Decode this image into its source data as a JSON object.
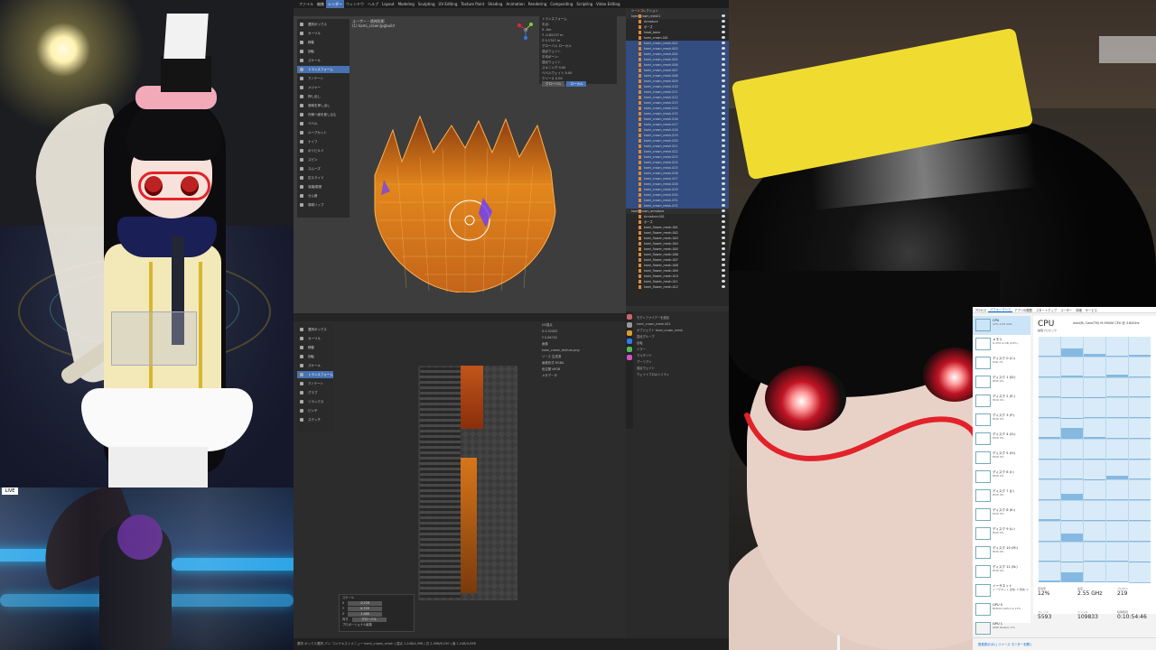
{
  "blender": {
    "menus": [
      "ファイル",
      "編集",
      "レンダー",
      "ウィンドウ",
      "ヘルプ",
      "Layout",
      "Modeling",
      "Sculpting",
      "UV Editing",
      "Texture Paint",
      "Shading",
      "Animation",
      "Rendering",
      "Compositing",
      "Scripting",
      "Video Editing"
    ],
    "active_menu_index": 2,
    "viewport": {
      "title": "ユーザー・透視投影",
      "subtitle": "(1) kami_crown|pgbuild",
      "tools": [
        "選択ボックス",
        "カーソル",
        "移動",
        "回転",
        "スケール",
        "トランスフォーム",
        "アノテート",
        "メジャー",
        "押し出し",
        "領域を押し出し",
        "内側へ面を差し込む",
        "ベベル",
        "ループカット",
        "ナイフ",
        "ポリビルド",
        "スピン",
        "スムーズ",
        "辺スライド",
        "収縮/膨張",
        "せん断",
        "領域リップ"
      ],
      "selected_tool_index": 5,
      "npanel": {
        "header": "トランスフォーム",
        "rows": [
          "中点:",
          "X  -0m",
          "Y  -0.62137 m",
          "Z  0.1747 m",
          "グローバル  ローカル",
          "頂点ウェイト",
          "平均ボーン:",
          "頂点ウェイト",
          "スキニング  0.00",
          "ベベルウェイト  0.00",
          "クリース  0.00"
        ],
        "tabs": [
          "グローバル",
          "ローカル"
        ]
      }
    },
    "outliner": {
      "title": "シーンコレクション",
      "rows": [
        {
          "label": "kami_crown_mesh1",
          "sel": false,
          "hdr": true
        },
        {
          "label": "Armature",
          "sel": false,
          "hdr": false
        },
        {
          "label": "ポーズ",
          "sel": false,
          "hdr": false
        },
        {
          "label": "head_bone",
          "sel": false,
          "hdr": false
        },
        {
          "label": "kami_crown.001",
          "sel": false,
          "hdr": false
        },
        {
          "label": "kami_crown_mesh.002",
          "sel": true,
          "hdr": false
        },
        {
          "label": "kami_crown_mesh.003",
          "sel": true,
          "hdr": false
        },
        {
          "label": "kami_crown_mesh.004",
          "sel": true,
          "hdr": false
        },
        {
          "label": "kami_crown_mesh.005",
          "sel": true,
          "hdr": false
        },
        {
          "label": "kami_crown_mesh.006",
          "sel": true,
          "hdr": false
        },
        {
          "label": "kami_crown_mesh.007",
          "sel": true,
          "hdr": false
        },
        {
          "label": "kami_crown_mesh.008",
          "sel": true,
          "hdr": false
        },
        {
          "label": "kami_crown_mesh.009",
          "sel": true,
          "hdr": false
        },
        {
          "label": "kami_crown_mesh.010",
          "sel": true,
          "hdr": false
        },
        {
          "label": "kami_crown_mesh.011",
          "sel": true,
          "hdr": false
        },
        {
          "label": "kami_crown_mesh.012",
          "sel": true,
          "hdr": false
        },
        {
          "label": "kami_crown_mesh.013",
          "sel": true,
          "hdr": false
        },
        {
          "label": "kami_crown_mesh.014",
          "sel": true,
          "hdr": false
        },
        {
          "label": "kami_crown_mesh.015",
          "sel": true,
          "hdr": false
        },
        {
          "label": "kami_crown_mesh.016",
          "sel": true,
          "hdr": false
        },
        {
          "label": "kami_crown_mesh.017",
          "sel": true,
          "hdr": false
        },
        {
          "label": "kami_crown_mesh.018",
          "sel": true,
          "hdr": false
        },
        {
          "label": "kami_crown_mesh.019",
          "sel": true,
          "hdr": false
        },
        {
          "label": "kami_crown_mesh.020",
          "sel": true,
          "hdr": false
        },
        {
          "label": "kami_crown_mesh.021",
          "sel": true,
          "hdr": false
        },
        {
          "label": "kami_crown_mesh.022",
          "sel": true,
          "hdr": false
        },
        {
          "label": "kami_crown_mesh.023",
          "sel": true,
          "hdr": false
        },
        {
          "label": "kami_crown_mesh.024",
          "sel": true,
          "hdr": false
        },
        {
          "label": "kami_crown_mesh.025",
          "sel": true,
          "hdr": false
        },
        {
          "label": "kami_crown_mesh.026",
          "sel": true,
          "hdr": false
        },
        {
          "label": "kami_crown_mesh.027",
          "sel": true,
          "hdr": false
        },
        {
          "label": "kami_crown_mesh.028",
          "sel": true,
          "hdr": false
        },
        {
          "label": "kami_crown_mesh.029",
          "sel": true,
          "hdr": false
        },
        {
          "label": "kami_crown_mesh.030",
          "sel": true,
          "hdr": false
        },
        {
          "label": "kami_crown_mesh.031",
          "sel": true,
          "hdr": false
        },
        {
          "label": "kami_crown_mesh.032",
          "sel": true,
          "hdr": false
        },
        {
          "label": "kami_crown_armature",
          "sel": false,
          "hdr": true
        },
        {
          "label": "Armature.001",
          "sel": false,
          "hdr": false
        },
        {
          "label": "ポーズ",
          "sel": false,
          "hdr": false
        },
        {
          "label": "kami_flower_mesh.001",
          "sel": false,
          "hdr": false
        },
        {
          "label": "kami_flower_mesh.002",
          "sel": false,
          "hdr": false
        },
        {
          "label": "kami_flower_mesh.003",
          "sel": false,
          "hdr": false
        },
        {
          "label": "kami_flower_mesh.004",
          "sel": false,
          "hdr": false
        },
        {
          "label": "kami_flower_mesh.005",
          "sel": false,
          "hdr": false
        },
        {
          "label": "kami_flower_mesh.006",
          "sel": false,
          "hdr": false
        },
        {
          "label": "kami_flower_mesh.007",
          "sel": false,
          "hdr": false
        },
        {
          "label": "kami_flower_mesh.008",
          "sel": false,
          "hdr": false
        },
        {
          "label": "kami_flower_mesh.009",
          "sel": false,
          "hdr": false
        },
        {
          "label": "kami_flower_mesh.010",
          "sel": false,
          "hdr": false
        },
        {
          "label": "kami_flower_mesh.011",
          "sel": false,
          "hdr": false
        },
        {
          "label": "kami_flower_mesh.012",
          "sel": false,
          "hdr": false
        }
      ]
    },
    "uv_editor": {
      "tools": [
        "選択ボックス",
        "カーソル",
        "移動",
        "回転",
        "スケール",
        "トランスフォーム",
        "アノテート",
        "グラブ",
        "リラックス",
        "ピンチ",
        "ステッチ"
      ],
      "selected_tool_index": 5,
      "npanel_rows": [
        "UV頂点",
        "X  0.52432",
        "Y  0.84741",
        "画像",
        "kami_crown_texture.png",
        "ソース  生成済",
        "画像形式  RGBA",
        "色空間  sRGB",
        "メタデータ"
      ]
    },
    "properties": {
      "rows": [
        "モディファイアーを追加",
        "kami_crown_mesh.001",
        "オブジェクト  kami_crown_mesh",
        "頂点グループ",
        "反転",
        "ミラー",
        "マルチリゾ",
        "ブーリアン",
        "頂点ウェイト",
        "ウェイトプロキシミティ"
      ]
    },
    "redo_panel": {
      "title": "スケール",
      "rows": [
        [
          "X",
          "0.729"
        ],
        [
          "Y",
          "0.729"
        ],
        [
          "Z",
          "1.000"
        ],
        [
          "向き",
          "グローバル"
        ],
        [
          "プロポーショナル編集",
          ""
        ]
      ]
    },
    "status_bar": "選択  ボックス選択  パン  コンテキストメニュー    kami_crown_mesh | 頂点 1,248/4,096 | 辺 2,496/8,190 | 面 1,248/4,096"
  },
  "taskmanager": {
    "tabs": [
      "プロセス",
      "パフォーマンス",
      "アプリの履歴",
      "スタートアップ",
      "ユーザー",
      "詳細",
      "サービス"
    ],
    "active_tab_index": 1,
    "sidebar": [
      {
        "name": "CPU",
        "sub": "12% 2.55 GHz",
        "sel": true
      },
      {
        "name": "メモリ",
        "sub": "9.4/31.9 GB (29%)",
        "sel": false
      },
      {
        "name": "ディスク 0 (C:)",
        "sub": "SSD 1%",
        "sel": false
      },
      {
        "name": "ディスク 1 (D:)",
        "sub": "HDD 0%",
        "sel": false
      },
      {
        "name": "ディスク 2 (E:)",
        "sub": "HDD 0%",
        "sel": false
      },
      {
        "name": "ディスク 3 (F:)",
        "sub": "HDD 0%",
        "sel": false
      },
      {
        "name": "ディスク 4 (G:)",
        "sub": "HDD 0%",
        "sel": false
      },
      {
        "name": "ディスク 5 (H:)",
        "sub": "HDD 0%",
        "sel": false
      },
      {
        "name": "ディスク 6 (I:)",
        "sub": "HDD 0%",
        "sel": false
      },
      {
        "name": "ディスク 7 (J:)",
        "sub": "HDD 0%",
        "sel": false
      },
      {
        "name": "ディスク 8 (K:)",
        "sub": "HDD 0%",
        "sel": false
      },
      {
        "name": "ディスク 9 (L:)",
        "sub": "HDD 0%",
        "sel": false
      },
      {
        "name": "ディスク 10 (M:)",
        "sub": "HDD 0%",
        "sel": false
      },
      {
        "name": "ディスク 11 (N:)",
        "sub": "HDD 0%",
        "sel": false
      },
      {
        "name": "イーサネット",
        "sub": "イーサネット 送信: 0 受信: 0",
        "sel": false
      },
      {
        "name": "GPU 0",
        "sub": "NVIDIA GeForce 13%",
        "sel": false
      },
      {
        "name": "GPU 1",
        "sub": "AMD Radeon 0%",
        "sel": false
      }
    ],
    "cpu_title": "CPU",
    "cpu_model": "Intel(R) Core(TM) i9-9900K CPU @ 3.60GHz",
    "graph_label": "論理プロセッサ",
    "core_loads": [
      2,
      40,
      12,
      5,
      8,
      3,
      6,
      4,
      10,
      2,
      5,
      3,
      2,
      4,
      6,
      3,
      2,
      5,
      3,
      4,
      8,
      55,
      6,
      4,
      5,
      3,
      2,
      4,
      3,
      2,
      5,
      4,
      3,
      20,
      8,
      6,
      30,
      5,
      4,
      3,
      6,
      5,
      4,
      2,
      5,
      3,
      40,
      4,
      3,
      2,
      4,
      3,
      4,
      5,
      2,
      8,
      50,
      6,
      3,
      2
    ],
    "stats": [
      {
        "label": "使用率",
        "value": "12%"
      },
      {
        "label": "速度",
        "value": "2.55 GHz"
      },
      {
        "label": "プロセス",
        "value": "219"
      },
      {
        "label": "スレッド",
        "value": "5593"
      },
      {
        "label": "ハンドル",
        "value": "109833"
      },
      {
        "label": "稼働時間",
        "value": "0:10:54:46"
      }
    ],
    "footer": "簡易表示(D)  |  リソース モニターを開く"
  },
  "dance_badge": "LIVE",
  "colors": {
    "blender_accent": "#4772b3",
    "selection_row": "#334d80",
    "crown_orange": "#e2861c",
    "headband_yellow": "#f0dc30",
    "glasses_red": "#e2222a",
    "taskmgr_accent": "#0066cc"
  }
}
